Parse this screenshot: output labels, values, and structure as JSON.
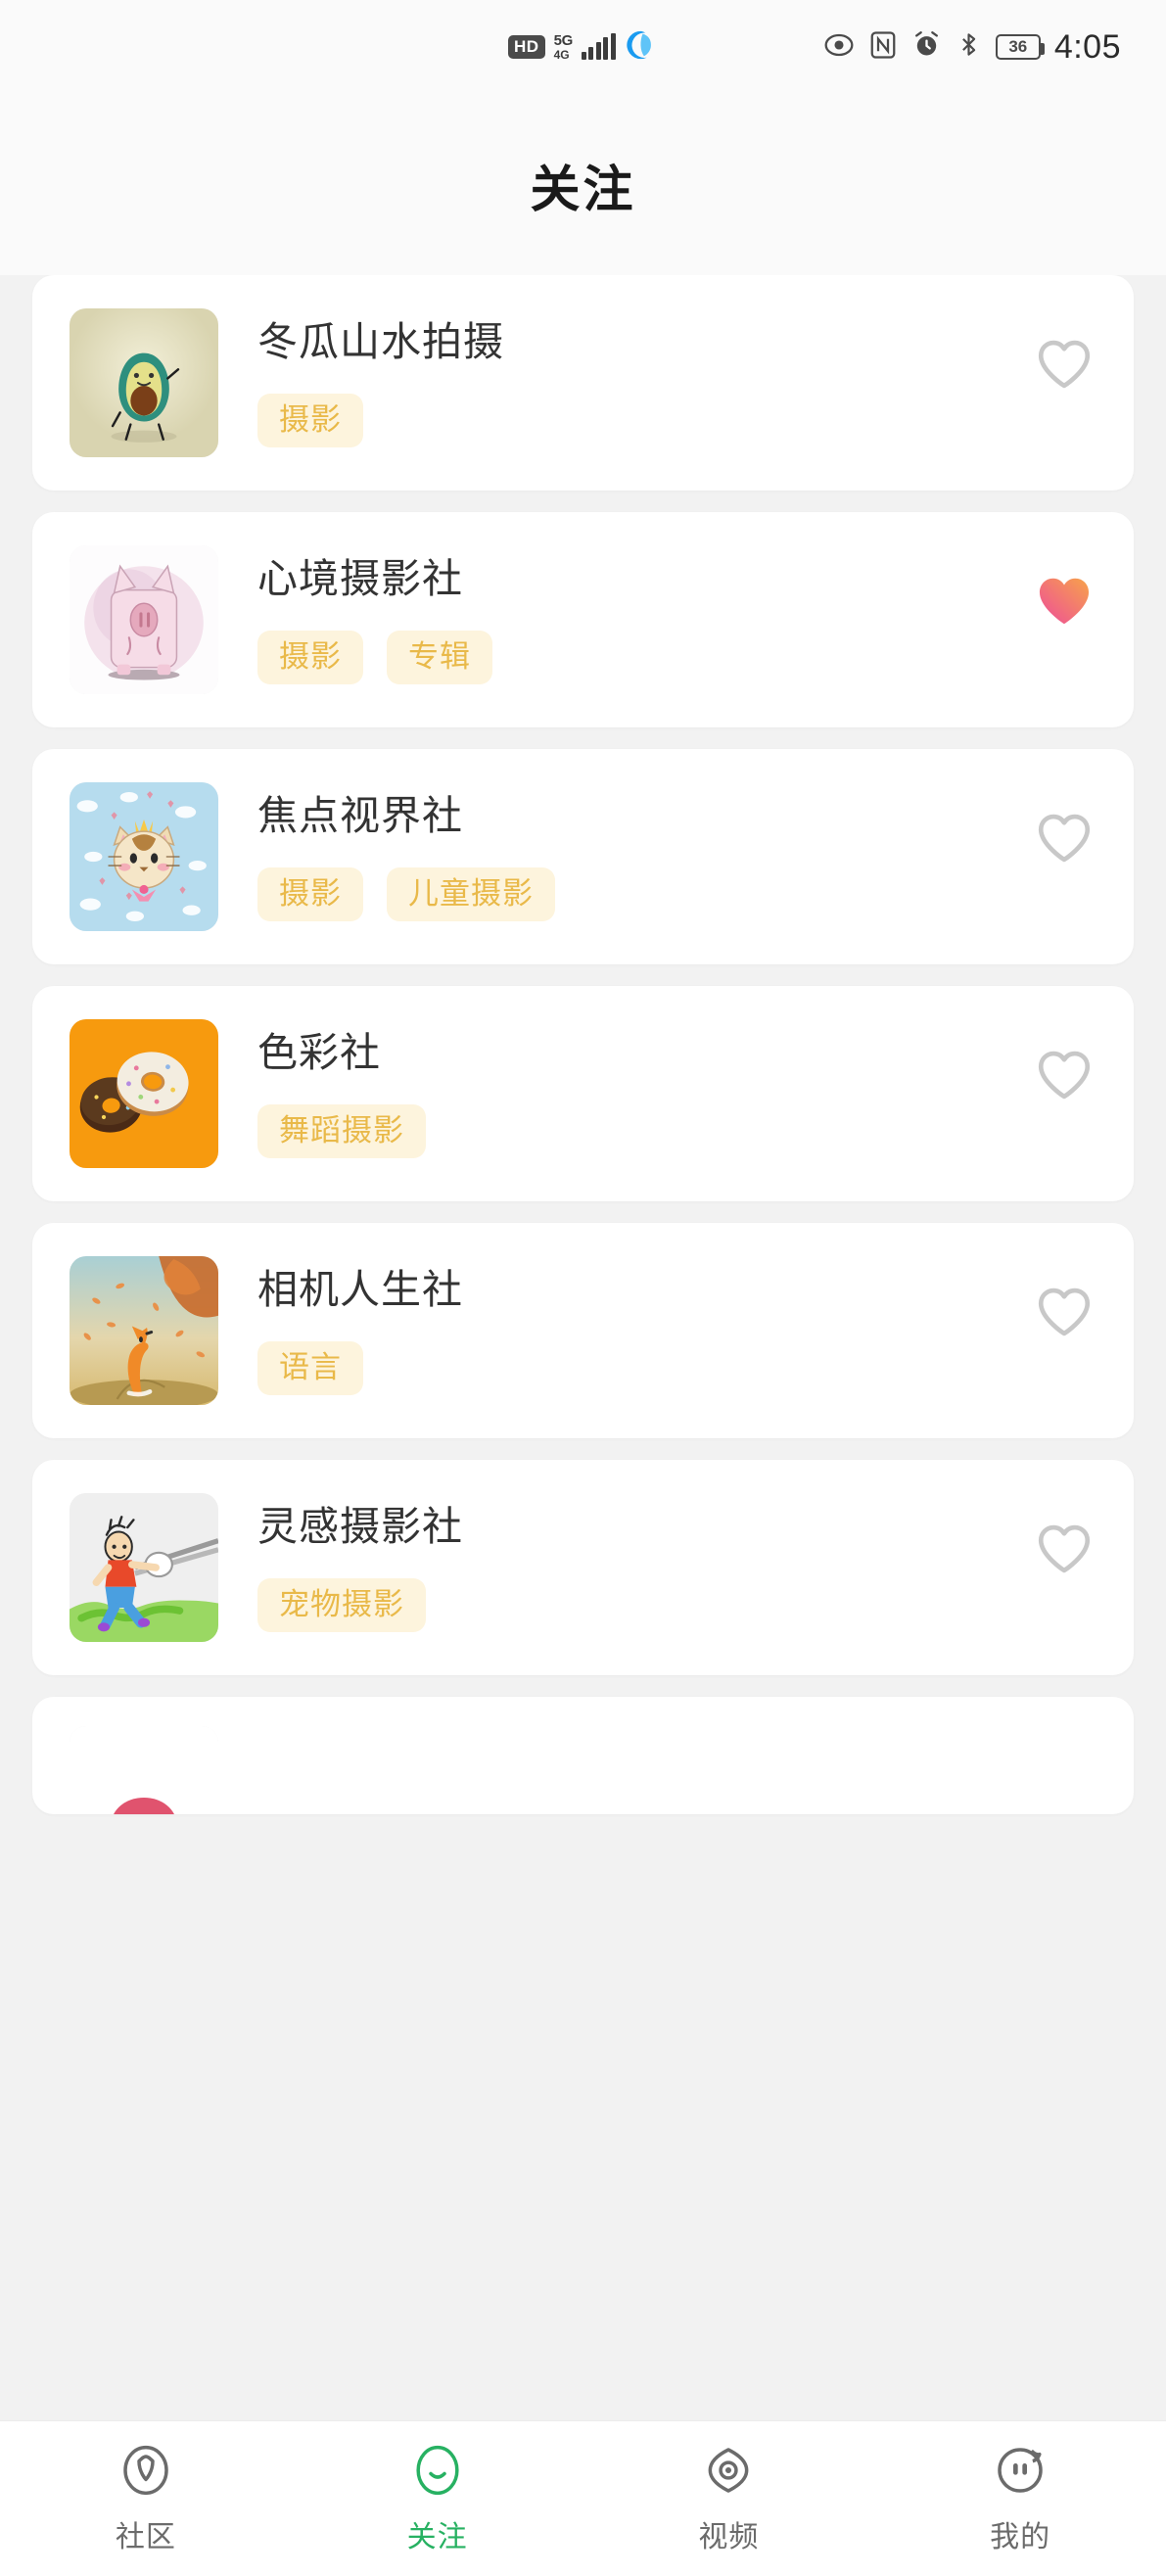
{
  "status_bar": {
    "hd_label": "HD",
    "network_type": "5G",
    "network_sub": "4G",
    "signal_icon": "signal-bars-icon",
    "browser_icon": "blue-orb-icon",
    "eye_icon": "eye-icon",
    "nfc_icon": "nfc-icon",
    "alarm_icon": "alarm-clock-icon",
    "bluetooth_icon": "bluetooth-icon",
    "battery_level": "36",
    "time": "4:05"
  },
  "header": {
    "title": "关注"
  },
  "cards": [
    {
      "name": "冬瓜山水拍摄",
      "tags": [
        "摄影"
      ],
      "liked": false,
      "thumb": "avocado-illustration"
    },
    {
      "name": "心境摄影社",
      "tags": [
        "摄影",
        "专辑"
      ],
      "liked": true,
      "thumb": "pig-watercolor-illustration"
    },
    {
      "name": "焦点视界社",
      "tags": [
        "摄影",
        "儿童摄影"
      ],
      "liked": false,
      "thumb": "crown-cat-clouds-illustration"
    },
    {
      "name": "色彩社",
      "tags": [
        "舞蹈摄影"
      ],
      "liked": false,
      "thumb": "donuts-orange-illustration"
    },
    {
      "name": "相机人生社",
      "tags": [
        "语言"
      ],
      "liked": false,
      "thumb": "fox-autumn-illustration"
    },
    {
      "name": "灵感摄影社",
      "tags": [
        "宠物摄影"
      ],
      "liked": false,
      "thumb": "boy-running-illustration"
    }
  ],
  "tabbar": {
    "items": [
      {
        "label": "社区",
        "icon": "leaf-compass-icon",
        "active": false
      },
      {
        "label": "关注",
        "icon": "smile-oval-icon",
        "active": true
      },
      {
        "label": "视频",
        "icon": "eye-ring-icon",
        "active": false
      },
      {
        "label": "我的",
        "icon": "face-profile-icon",
        "active": false
      }
    ]
  },
  "colors": {
    "page_background": "#f2f2f2",
    "card_background": "#ffffff",
    "tag_background": "#fdf4dd",
    "tag_text": "#e9b949",
    "heart_outline": "#c8c8c8",
    "heart_fill_start": "#f7a34a",
    "heart_fill_end": "#ee4c9b",
    "active_tab": "#27b162",
    "title_text": "#1a1a1a"
  }
}
